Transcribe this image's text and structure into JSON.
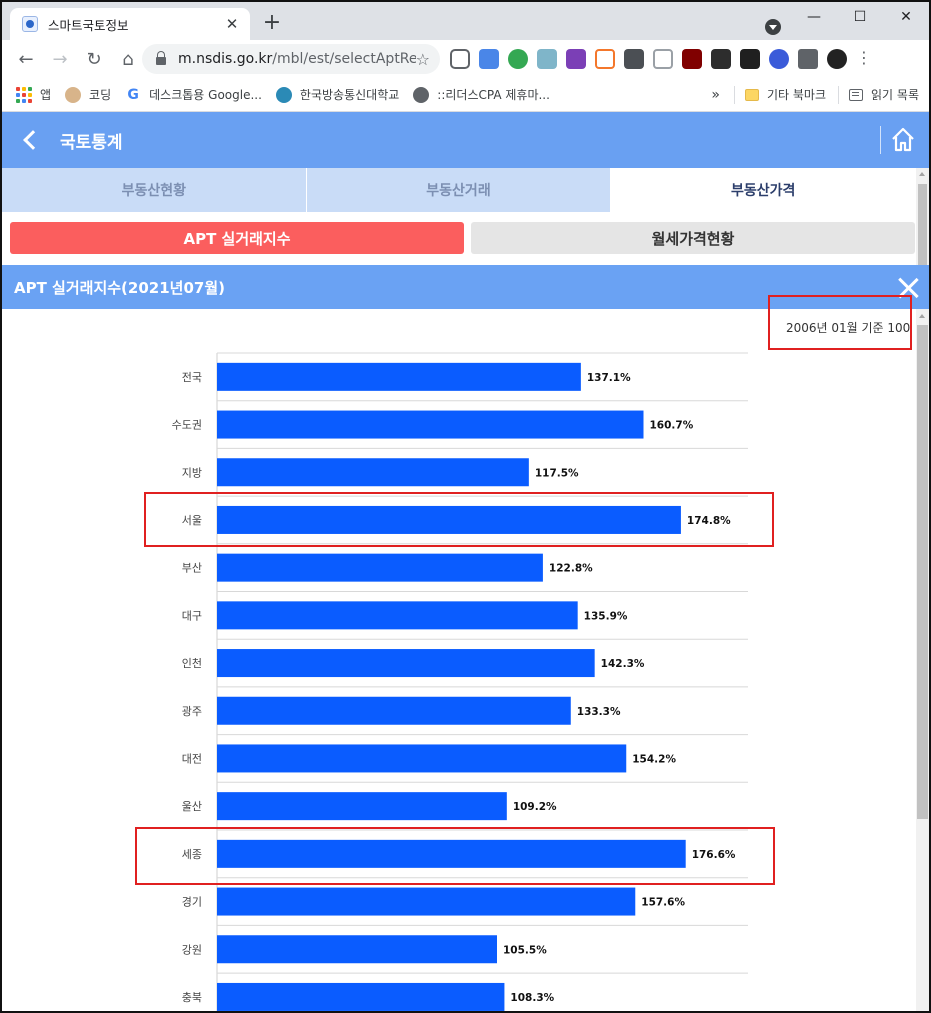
{
  "browser": {
    "tab_title": "스마트국토정보",
    "url_host": "m.nsdis.go.kr",
    "url_path": "/mbl/est/selectAptRe...",
    "bookmarks": [
      {
        "label": "앱",
        "icon": "apps-grid-icon"
      },
      {
        "label": "코딩",
        "icon": "dog-icon"
      },
      {
        "label": "데스크톱용 Google...",
        "icon": "google-g-icon"
      },
      {
        "label": "한국방송통신대학교",
        "icon": "knou-icon"
      },
      {
        "label": "::리더스CPA 제휴마...",
        "icon": "globe-icon"
      }
    ],
    "bookmarks_more": "»",
    "other_bookmarks": "기타 북마크",
    "reading_list": "읽기 목록"
  },
  "site": {
    "title": "국토통계",
    "main_tabs": [
      {
        "label": "부동산현황",
        "active": false
      },
      {
        "label": "부동산거래",
        "active": false
      },
      {
        "label": "부동산가격",
        "active": true
      }
    ],
    "sub_tabs": [
      {
        "label": "APT 실거래지수",
        "active": true
      },
      {
        "label": "월세가격현황",
        "active": false
      }
    ]
  },
  "panel": {
    "title": "APT 실거래지수(2021년07월)",
    "base_note": "2006년 01월 기준 100"
  },
  "chart_data": {
    "type": "bar",
    "orientation": "horizontal",
    "bar_color": "#0a5cff",
    "value_suffix": "%",
    "categories": [
      "전국",
      "수도권",
      "지방",
      "서울",
      "부산",
      "대구",
      "인천",
      "광주",
      "대전",
      "울산",
      "세종",
      "경기",
      "강원",
      "충북"
    ],
    "values": [
      137.1,
      160.7,
      117.5,
      174.8,
      122.8,
      135.9,
      142.3,
      133.3,
      154.2,
      109.2,
      176.6,
      157.6,
      105.5,
      108.3
    ],
    "highlighted": [
      "서울",
      "세종"
    ],
    "xlim": [
      0,
      200
    ],
    "grid": true
  },
  "colors": {
    "header_blue": "#69a0f2",
    "active_subtab_red": "#fb5e5e",
    "annotation_red": "#e02020"
  }
}
